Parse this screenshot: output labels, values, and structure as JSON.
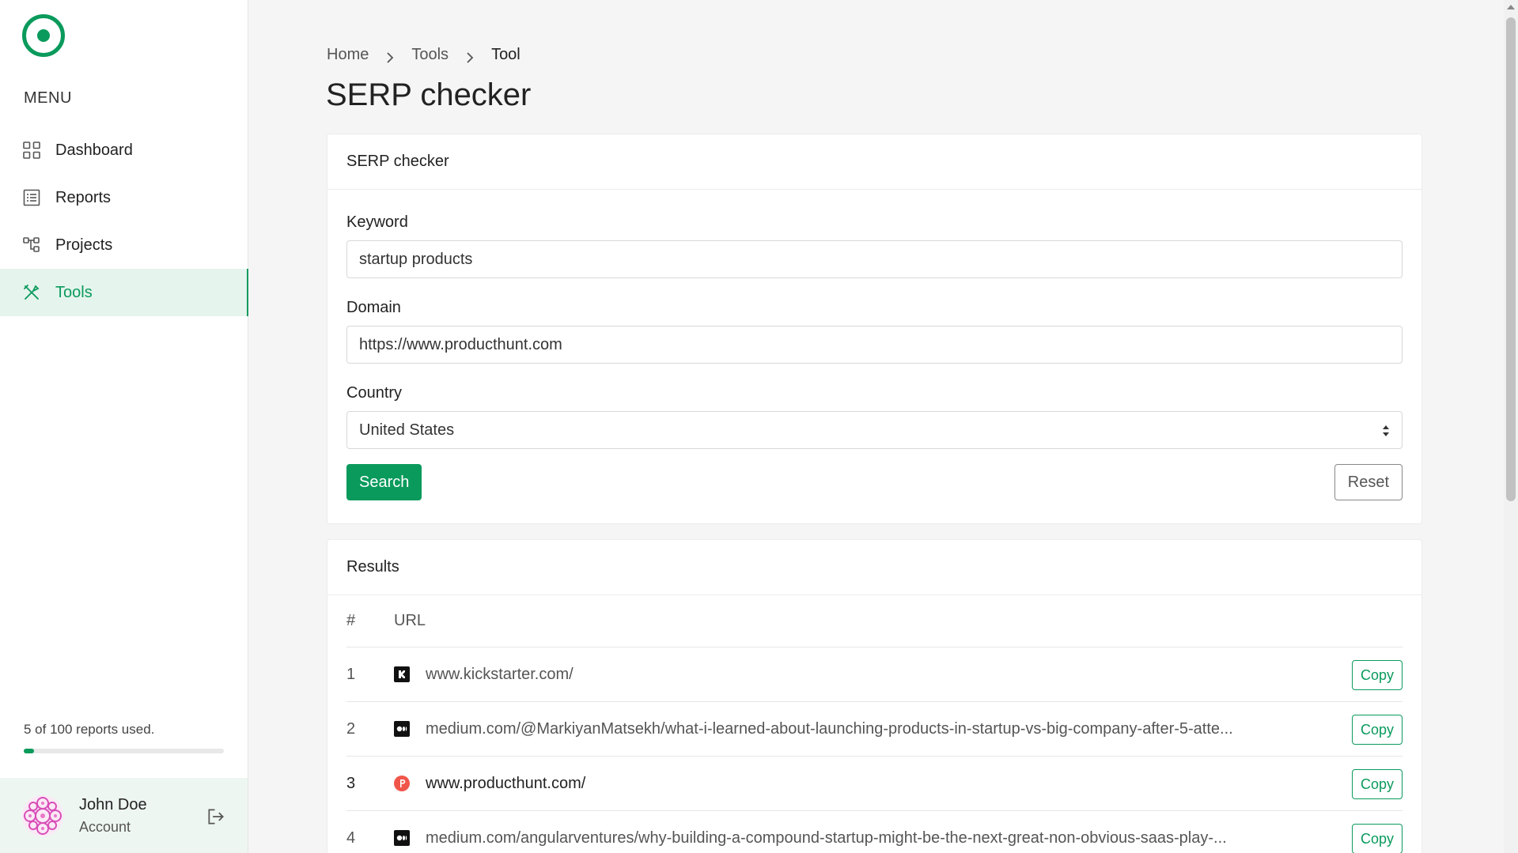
{
  "sidebar": {
    "menu_title": "MENU",
    "items": [
      {
        "label": "Dashboard",
        "icon": "grid-icon",
        "active": false
      },
      {
        "label": "Reports",
        "icon": "list-icon",
        "active": false
      },
      {
        "label": "Projects",
        "icon": "hierarchy-icon",
        "active": false
      },
      {
        "label": "Tools",
        "icon": "tools-icon",
        "active": true
      }
    ],
    "usage_text": "5 of 100 reports used.",
    "usage_fraction": 0.05,
    "account": {
      "name": "John Doe",
      "subtitle": "Account"
    }
  },
  "breadcrumb": [
    "Home",
    "Tools",
    "Tool"
  ],
  "page_title": "SERP checker",
  "form_card": {
    "title": "SERP checker",
    "keyword_label": "Keyword",
    "keyword_value": "startup products",
    "domain_label": "Domain",
    "domain_value": "https://www.producthunt.com",
    "country_label": "Country",
    "country_value": "United States",
    "search_label": "Search",
    "reset_label": "Reset"
  },
  "results_card": {
    "title": "Results",
    "columns": [
      "#",
      "URL"
    ],
    "copy_label": "Copy",
    "rows": [
      {
        "num": "1",
        "url": "www.kickstarter.com/",
        "favicon": "kickstarter-favicon",
        "highlight": false
      },
      {
        "num": "2",
        "url": "medium.com/@MarkiyanMatsekh/what-i-learned-about-launching-products-in-startup-vs-big-company-after-5-atte...",
        "favicon": "medium-favicon",
        "highlight": false
      },
      {
        "num": "3",
        "url": "www.producthunt.com/",
        "favicon": "producthunt-favicon",
        "highlight": true
      },
      {
        "num": "4",
        "url": "medium.com/angularventures/why-building-a-compound-startup-might-be-the-next-great-non-obvious-saas-play-...",
        "favicon": "medium-favicon",
        "highlight": false
      }
    ]
  },
  "colors": {
    "accent": "#0a9a5c",
    "active_bg": "#e5f4ed",
    "producthunt": "#f0554a"
  }
}
